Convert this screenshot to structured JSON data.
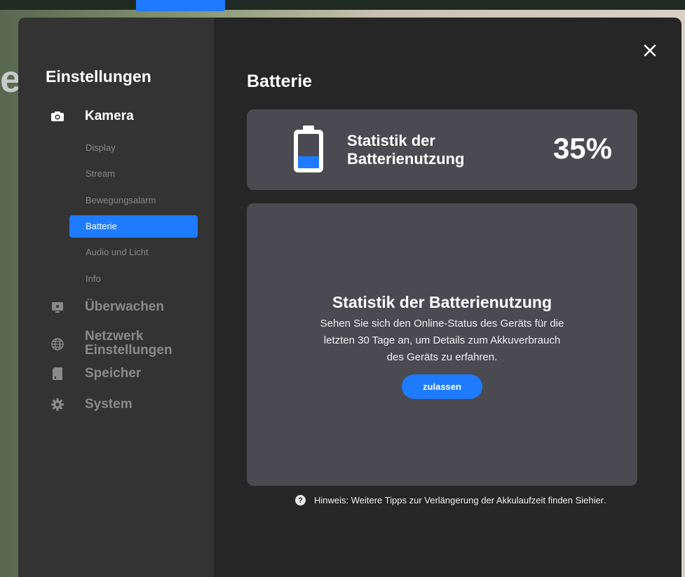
{
  "sidebar": {
    "title": "Einstellungen",
    "sections": [
      {
        "label": "Kamera",
        "icon": "camera-icon"
      },
      {
        "label": "Überwachen",
        "icon": "monitor-icon"
      },
      {
        "label": "Netzwerk Einstellungen",
        "icon": "globe-icon"
      },
      {
        "label": "Speicher",
        "icon": "storage-card-icon"
      },
      {
        "label": "System",
        "icon": "gear-icon"
      }
    ],
    "camera_items": [
      {
        "label": "Display"
      },
      {
        "label": "Stream"
      },
      {
        "label": "Bewegungsalarm"
      },
      {
        "label": "Batterie"
      },
      {
        "label": "Audio und Licht"
      },
      {
        "label": "Info"
      }
    ]
  },
  "main": {
    "title": "Batterie",
    "battery_card": {
      "label": "Statistik der Batterienutzung",
      "percent": "35%",
      "level": 0.35
    },
    "stats_card": {
      "title": "Statistik der Batterienutzung",
      "description": "Sehen Sie sich den Online-Status des Geräts für die letzten 30 Tage an, um Details zum Akkuverbrauch des Geräts zu erfahren.",
      "button_label": "zulassen"
    },
    "hint": {
      "icon": "question-icon",
      "text": "Hinweis: Weitere Tipps zur Verlängerung der Akkulaufzeit finden Sie ",
      "link": "hier",
      "trailing": "."
    }
  },
  "colors": {
    "accent": "#1e7bff",
    "dialog_bg": "#262626",
    "sidebar_bg": "#333333",
    "card_bg": "#4a4a50"
  }
}
